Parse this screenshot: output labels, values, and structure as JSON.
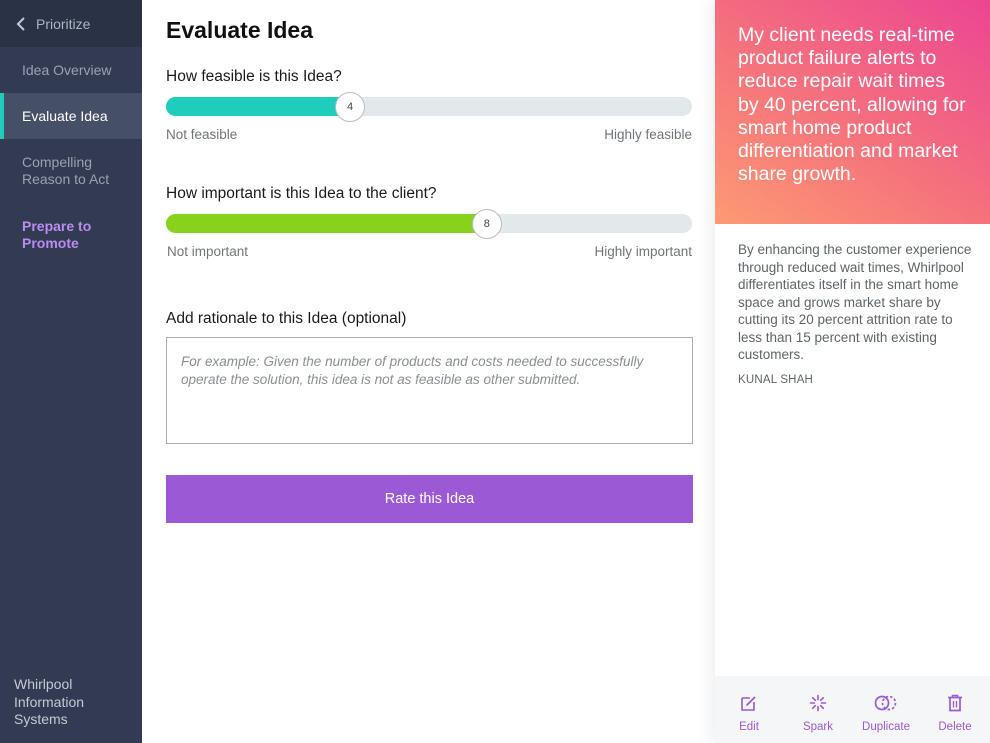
{
  "colors": {
    "accent": "#9b59d5",
    "teal": "#1ecdbb",
    "green": "#86d21c",
    "sidebar": "#323b52"
  },
  "sidebar": {
    "back_label": "Prioritize",
    "items": [
      {
        "label": "Idea Overview",
        "active": false
      },
      {
        "label": "Evaluate Idea",
        "active": true
      },
      {
        "label": "Compelling Reason to Act",
        "active": false
      },
      {
        "label": "Prepare to Promote",
        "active": false
      }
    ],
    "company": "Whirlpool Information Systems"
  },
  "main": {
    "title": "Evaluate Idea",
    "feasibility": {
      "question": "How feasible is this Idea?",
      "value": "4",
      "fraction": 0.35,
      "min_label": "Not feasible",
      "max_label": "Highly feasible"
    },
    "importance": {
      "question": "How important is this Idea to the client?",
      "value": "8",
      "fraction": 0.61,
      "min_label": "Not important",
      "max_label": "Highly important"
    },
    "rationale": {
      "label": "Add rationale to this Idea (optional)",
      "placeholder": "For example: Given the number of products and costs needed to successfully operate the solution, this idea is not as feasible as other submitted.",
      "value": ""
    },
    "rate_button": "Rate this Idea"
  },
  "idea": {
    "headline": "My client needs real-time product failure alerts to reduce repair wait times by 40 percent, allowing for smart home product differentiation and market share growth.",
    "description": "By enhancing the customer experience through reduced wait times, Whirlpool differentiates itself in the smart home space and grows market share by cutting its 20 percent attrition rate to less than 15 percent with existing customers.",
    "author": "KUNAL SHAH"
  },
  "actions": [
    {
      "label": "Edit",
      "icon": "edit-icon"
    },
    {
      "label": "Spark",
      "icon": "spark-icon"
    },
    {
      "label": "Duplicate",
      "icon": "duplicate-icon"
    },
    {
      "label": "Delete",
      "icon": "trash-icon"
    }
  ]
}
